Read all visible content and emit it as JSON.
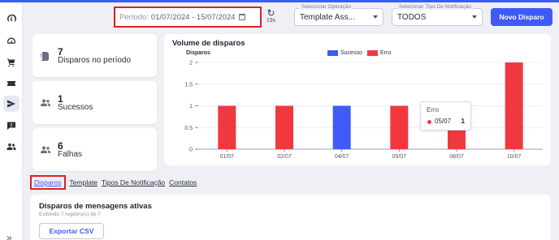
{
  "header": {
    "period_label": "Período:",
    "period_value": "01/07/2024 - 15/07/2024",
    "refresh_time": "19s",
    "operation": {
      "label": "Selecionar Operação",
      "value": "Template Ass..."
    },
    "notification_type": {
      "label": "Selecionar Tipo De Notificação",
      "value": "TODOS"
    },
    "new_button": "Novo Disparo"
  },
  "stats": [
    {
      "value": "7",
      "label": "Disparos no período",
      "icon": "document-icon"
    },
    {
      "value": "1",
      "label": "Sucessos",
      "icon": "users-icon"
    },
    {
      "value": "6",
      "label": "Falhas",
      "icon": "users-icon"
    }
  ],
  "chart_data": {
    "type": "bar",
    "title": "Volume de disparos",
    "ylabel": "Disparos",
    "categories": [
      "01/07",
      "02/07",
      "04/07",
      "05/07",
      "08/07",
      "10/07"
    ],
    "series": [
      {
        "name": "Sucesso",
        "color": "#3f5bf6",
        "values": [
          0,
          0,
          1,
          0,
          0,
          0
        ]
      },
      {
        "name": "Erro",
        "color": "#f2383f",
        "values": [
          1,
          1,
          0,
          1,
          1,
          2
        ]
      }
    ],
    "ylim": [
      0,
      2
    ],
    "yticks": [
      "0",
      "0.5",
      "1",
      "1.5",
      "2"
    ],
    "tooltip": {
      "title": "Erro",
      "date": "05/07",
      "value": "1"
    }
  },
  "tabs": [
    "Disparos",
    "Template",
    "Tipos De Notificação",
    "Contatos"
  ],
  "panel": {
    "title": "Disparos de mensagens ativas",
    "subtitle": "Exibindo 7 registro(s) de 7",
    "export_button": "Exportar CSV"
  },
  "sidebar": {
    "items": [
      "dashboard-gauge-icon",
      "speedometer-icon",
      "cart-icon",
      "ticket-icon",
      "send-icon",
      "chat-alert-icon",
      "people-icon"
    ],
    "collapse": "»"
  }
}
